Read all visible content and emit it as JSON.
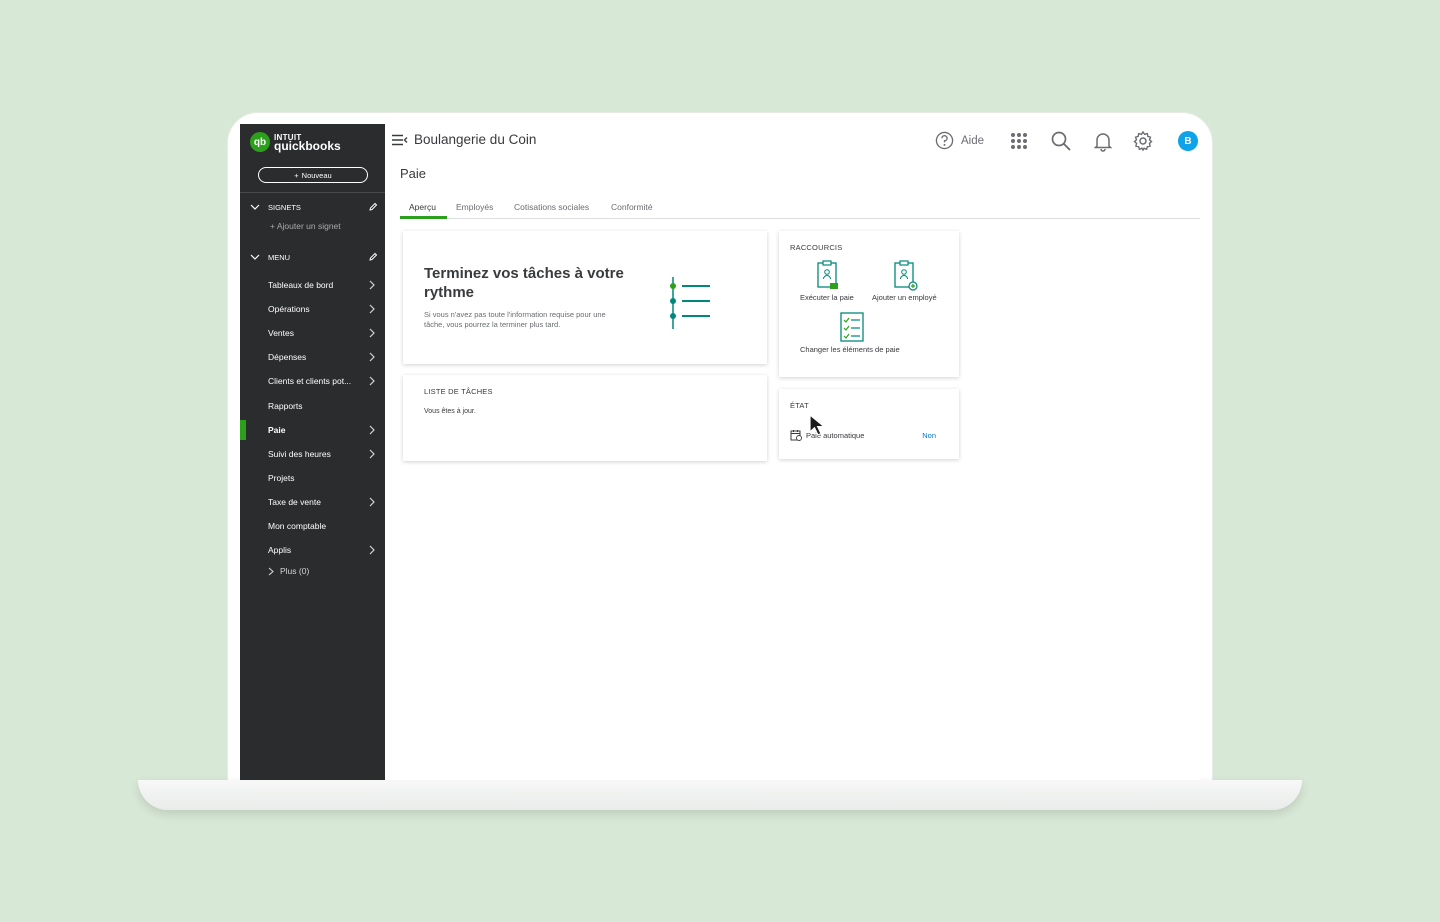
{
  "brand": {
    "intuit": "INTUIT",
    "product": "quickbooks",
    "logo_mark": "qb"
  },
  "sidebar": {
    "new_button": "Nouveau",
    "bookmarks_header": "SIGNETS",
    "add_bookmark": "Ajouter un signet",
    "menu_header": "MENU",
    "items": [
      {
        "label": "Tableaux de bord",
        "has_arrow": true
      },
      {
        "label": "Opérations",
        "has_arrow": true
      },
      {
        "label": "Ventes",
        "has_arrow": true
      },
      {
        "label": "Dépenses",
        "has_arrow": true
      },
      {
        "label": "Clients et clients pot...",
        "has_arrow": true
      },
      {
        "label": "Rapports",
        "has_arrow": false
      },
      {
        "label": "Paie",
        "has_arrow": true,
        "active": true
      },
      {
        "label": "Suivi des heures",
        "has_arrow": true
      },
      {
        "label": "Projets",
        "has_arrow": false
      },
      {
        "label": "Taxe de vente",
        "has_arrow": true
      },
      {
        "label": "Mon comptable",
        "has_arrow": false
      },
      {
        "label": "Applis",
        "has_arrow": true
      }
    ],
    "more": "Plus (0)"
  },
  "header": {
    "company": "Boulangerie du Coin",
    "help": "Aide",
    "avatar_initial": "B",
    "icons": [
      "menu-collapse-icon",
      "help-icon",
      "apps-grid-icon",
      "search-icon",
      "bell-icon",
      "gear-icon"
    ]
  },
  "page": {
    "title": "Paie",
    "tabs": [
      "Aperçu",
      "Employés",
      "Cotisations sociales",
      "Conformité"
    ],
    "active_tab": "Aperçu"
  },
  "task_card": {
    "title": "Terminez vos tâches à votre rythme",
    "description": "Si vous n'avez pas toute l'information requise pour une tâche, vous pourrez la terminer plus tard."
  },
  "task_list": {
    "header": "LISTE DE TÂCHES",
    "note": "Vous êtes à jour."
  },
  "shortcuts": {
    "header": "RACCOURCIS",
    "items": [
      {
        "label": "Exécuter la paie",
        "icon": "run-payroll-icon"
      },
      {
        "label": "Ajouter un employé",
        "icon": "add-employee-icon"
      },
      {
        "label": "Changer les éléments de paie",
        "icon": "payroll-items-icon"
      }
    ]
  },
  "status": {
    "header": "ÉTAT",
    "rows": [
      {
        "label": "Paie automatique",
        "value": "Non",
        "icon": "calendar-icon"
      }
    ]
  },
  "colors": {
    "background": "#d8e8d6",
    "sidebar": "#2b2c2e",
    "brand_green": "#2ca01c",
    "link_blue": "#0077c5",
    "avatar_blue": "#0ea2e8",
    "teal_accent": "#00897b"
  }
}
